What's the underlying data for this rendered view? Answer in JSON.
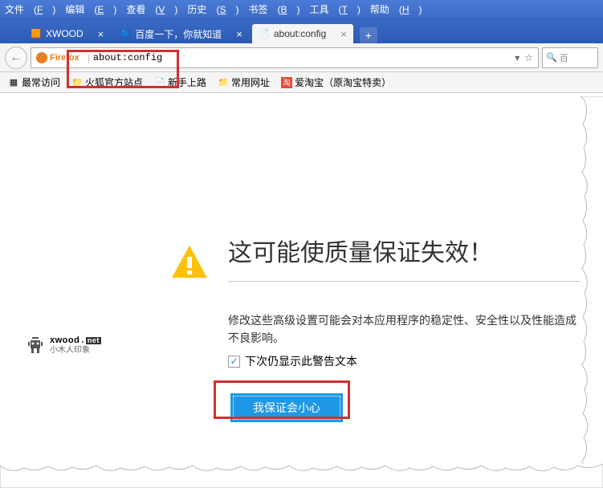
{
  "menus": [
    {
      "label": "文件",
      "key": "F"
    },
    {
      "label": "编辑",
      "key": "E"
    },
    {
      "label": "查看",
      "key": "V"
    },
    {
      "label": "历史",
      "key": "S"
    },
    {
      "label": "书签",
      "key": "B"
    },
    {
      "label": "工具",
      "key": "T"
    },
    {
      "label": "帮助",
      "key": "H"
    }
  ],
  "tabs": [
    {
      "label": "XWOOD",
      "active": false
    },
    {
      "label": "百度一下，你就知道",
      "active": false
    },
    {
      "label": "about:config",
      "active": true
    }
  ],
  "addressbar": {
    "brand": "Firefox",
    "url": "about:config"
  },
  "searchbox": {
    "placeholder": "百"
  },
  "bookmarks": [
    {
      "icon": "grid",
      "label": "最常访问",
      "color": "#666"
    },
    {
      "icon": "folder",
      "label": "火狐官方站点",
      "color": "#f0c84a"
    },
    {
      "icon": "page",
      "label": "新手上路",
      "color": "#ccc"
    },
    {
      "icon": "folder",
      "label": "常用网址",
      "color": "#f0c84a"
    },
    {
      "icon": "tao",
      "label": "爱淘宝（原淘宝特卖）",
      "color": "#e74c3c"
    }
  ],
  "warning": {
    "title": "这可能使质量保证失效！",
    "body": "修改这些高级设置可能会对本应用程序的稳定性、安全性以及性能造成不良影响。",
    "checkbox_label": "下次仍显示此警告文本",
    "button_label": "我保证会小心"
  },
  "watermark": {
    "url": "xwood",
    "tld": "net",
    "cn": "小木人印象"
  }
}
